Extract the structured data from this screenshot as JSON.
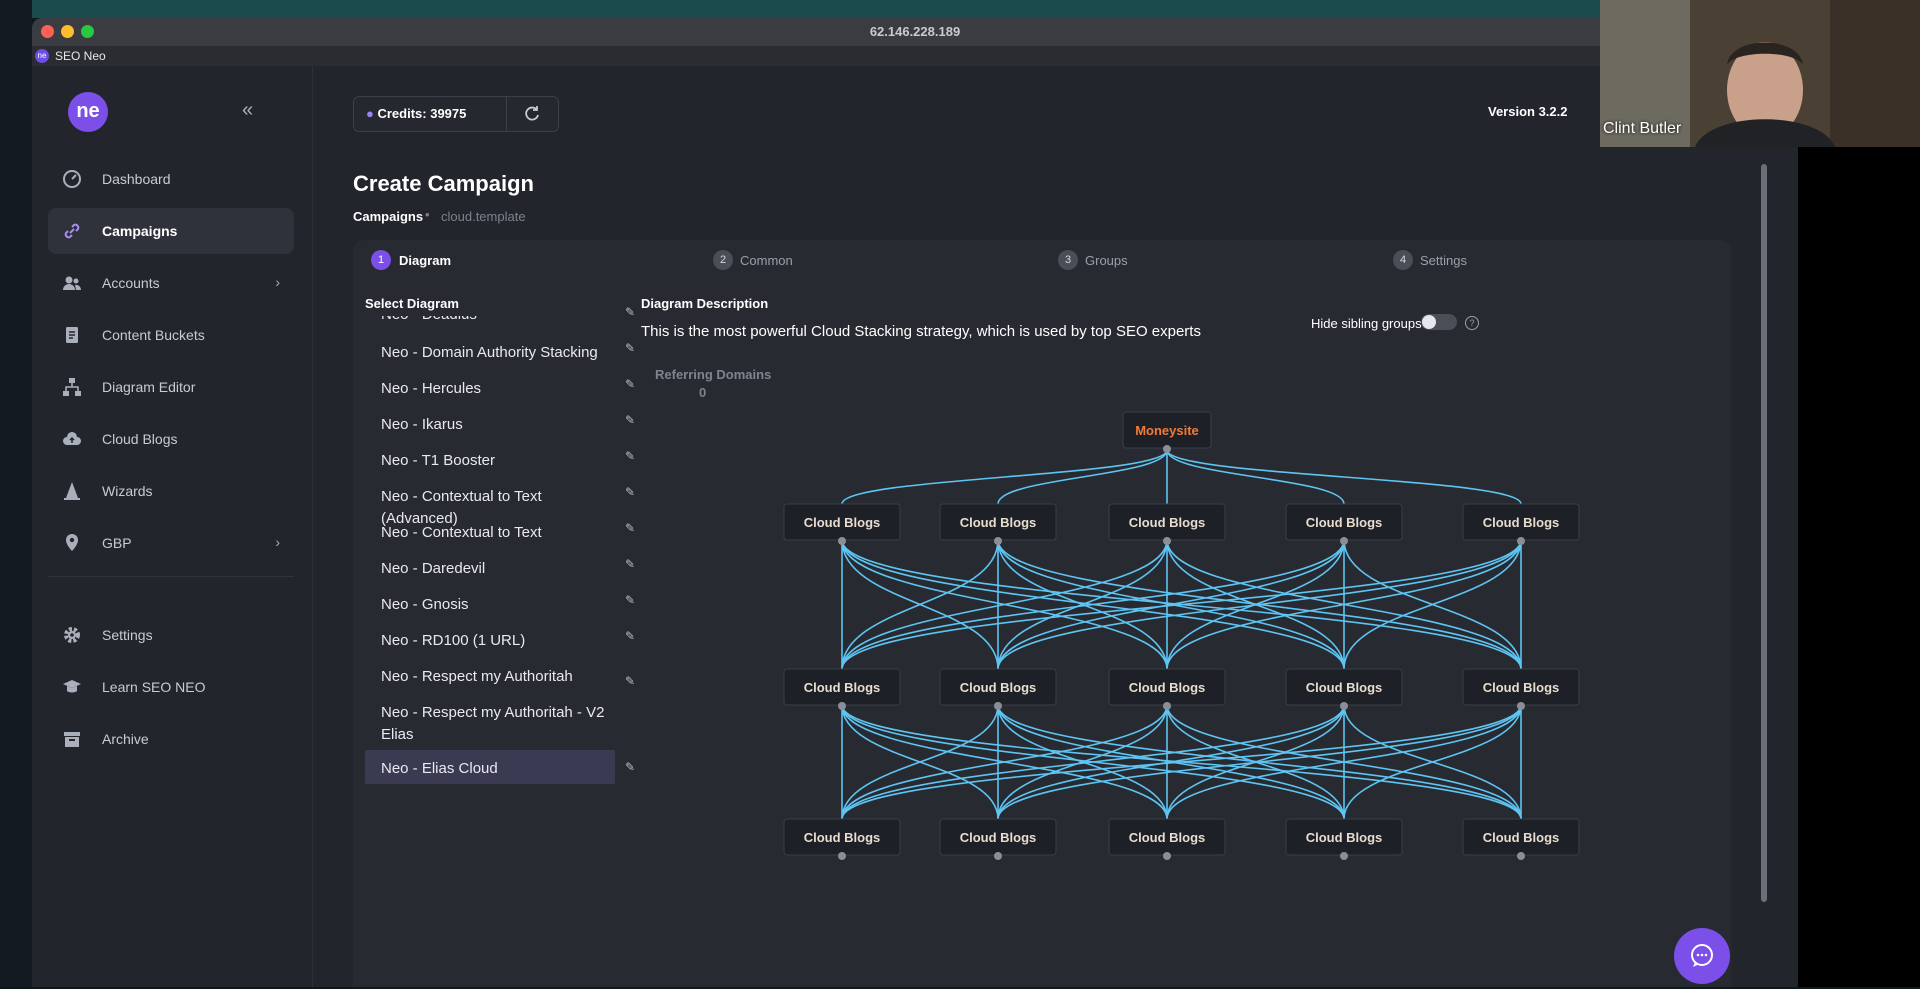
{
  "browser": {
    "url": "62.146.228.189",
    "tab_title": "SEO Neo",
    "tab_icon_text": "ne"
  },
  "sidebar": {
    "logo_text": "ne",
    "items": [
      {
        "label": "Dashboard",
        "icon": "dashboard-icon",
        "active": false,
        "chevron": false
      },
      {
        "label": "Campaigns",
        "icon": "link-icon",
        "active": true,
        "chevron": false
      },
      {
        "label": "Accounts",
        "icon": "users-icon",
        "active": false,
        "chevron": true
      },
      {
        "label": "Content Buckets",
        "icon": "document-icon",
        "active": false,
        "chevron": false
      },
      {
        "label": "Diagram Editor",
        "icon": "hierarchy-icon",
        "active": false,
        "chevron": false
      },
      {
        "label": "Cloud Blogs",
        "icon": "cloud-upload-icon",
        "active": false,
        "chevron": false
      },
      {
        "label": "Wizards",
        "icon": "wizard-icon",
        "active": false,
        "chevron": false
      },
      {
        "label": "GBP",
        "icon": "location-pin-icon",
        "active": false,
        "chevron": true
      }
    ],
    "bottom_items": [
      {
        "label": "Settings",
        "icon": "gear-icon"
      },
      {
        "label": "Learn SEO NEO",
        "icon": "graduation-cap-icon"
      },
      {
        "label": "Archive",
        "icon": "archive-icon"
      }
    ]
  },
  "header": {
    "credits_label": "Credits: 39975",
    "version": "Version 3.2.2"
  },
  "page": {
    "title": "Create Campaign",
    "breadcrumb": [
      "Campaigns",
      "cloud.template"
    ],
    "breadcrumb_separator": "•"
  },
  "steps": [
    {
      "num": "1",
      "label": "Diagram",
      "active": true
    },
    {
      "num": "2",
      "label": "Common",
      "active": false
    },
    {
      "num": "3",
      "label": "Groups",
      "active": false
    },
    {
      "num": "4",
      "label": "Settings",
      "active": false
    }
  ],
  "diagram_list": {
    "title": "Select Diagram",
    "partial_item": "Neo - Deadlus",
    "items": [
      {
        "label": "Neo - Domain Authority Stacking",
        "selected": false
      },
      {
        "label": "Neo - Hercules",
        "selected": false
      },
      {
        "label": "Neo - Ikarus",
        "selected": false
      },
      {
        "label": "Neo - T1 Booster",
        "selected": false
      },
      {
        "label": "Neo - Contextual to Text (Advanced)",
        "selected": false
      },
      {
        "label": "Neo - Contextual to Text",
        "selected": false
      },
      {
        "label": "Neo - Daredevil",
        "selected": false
      },
      {
        "label": "Neo - Gnosis",
        "selected": false
      },
      {
        "label": "Neo - RD100 (1 URL)",
        "selected": false
      },
      {
        "label": "Neo - Respect my Authoritah",
        "selected": false
      },
      {
        "label": "Neo - Respect my Authoritah - V2 Elias",
        "selected": false
      },
      {
        "label": "Neo - Elias Cloud",
        "selected": true
      }
    ]
  },
  "description": {
    "title": "Diagram Description",
    "text": "This is the most powerful Cloud Stacking strategy, which is used by top SEO experts",
    "hide_sibling_label": "Hide sibling groups",
    "hide_sibling_on": false,
    "help_glyph": "?"
  },
  "diagram": {
    "referring_domains_label": "Referring Domains",
    "referring_domains_value": "0",
    "root_label": "Moneysite",
    "node_label": "Cloud Blogs",
    "tiers": 3,
    "nodes_per_tier": 5,
    "colors": {
      "root_text": "#f27a3a",
      "link": "#5ec4f2",
      "node_bg": "#1d2026"
    }
  },
  "overlay": {
    "webcam_name": "Clint Butler"
  },
  "colors": {
    "accent": "#7b4fe8",
    "sidebar_bg": "#22252c",
    "card_bg": "#272a31"
  }
}
